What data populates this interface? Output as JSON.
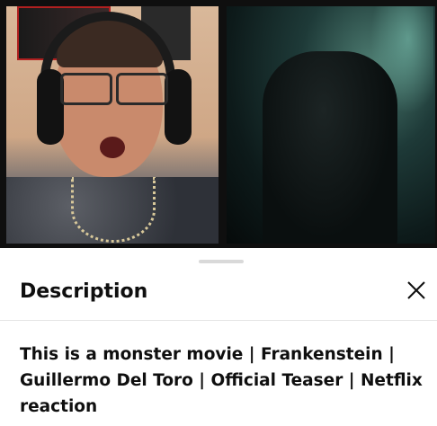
{
  "description_panel": {
    "heading": "Description",
    "close_icon": "close-icon",
    "video_title": "This is a monster movie | Frankenstein | Guillermo Del Toro | Official Teaser | Netflix reaction"
  },
  "video": {
    "left_panel": "reactor-webcam",
    "right_panel": "trailer-clip"
  },
  "colors": {
    "sheet_bg": "#ffffff",
    "text": "#0f0f0f",
    "handle": "#d9d9d9",
    "divider": "#e5e5e5"
  }
}
